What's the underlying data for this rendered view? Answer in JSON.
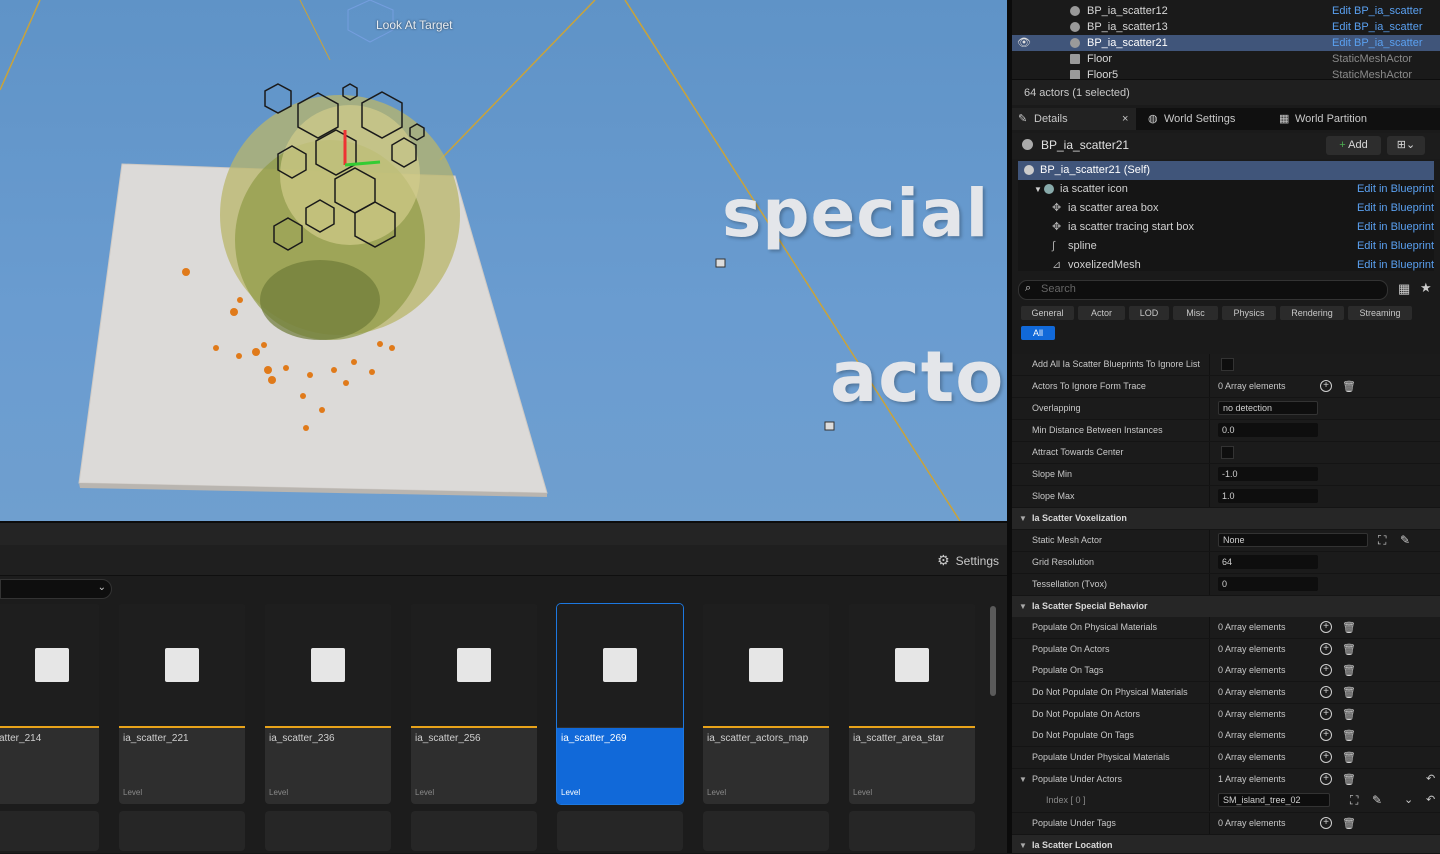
{
  "viewport": {
    "look_at_label": "Look At Target",
    "overlay_text_1": "special",
    "overlay_text_2": "acto"
  },
  "content_browser": {
    "settings_label": "Settings",
    "tiles": [
      {
        "name": "atter_214",
        "type": ""
      },
      {
        "name": "ia_scatter_221",
        "type": "Level"
      },
      {
        "name": "ia_scatter_236",
        "type": "Level"
      },
      {
        "name": "ia_scatter_256",
        "type": "Level"
      },
      {
        "name": "ia_scatter_269",
        "type": "Level"
      },
      {
        "name": "ia_scatter_actors_map",
        "type": "Level"
      },
      {
        "name": "ia_scatter_area_star",
        "type": "Level"
      }
    ]
  },
  "outliner": {
    "rows": [
      {
        "name": "BP_ia_scatter12",
        "type": "Edit BP_ia_scatter"
      },
      {
        "name": "BP_ia_scatter13",
        "type": "Edit BP_ia_scatter"
      },
      {
        "name": "BP_ia_scatter21",
        "type": "Edit BP_ia_scatter"
      },
      {
        "name": "Floor",
        "type": "StaticMeshActor"
      },
      {
        "name": "Floor5",
        "type": "StaticMeshActor"
      }
    ],
    "count": "64 actors (1 selected)"
  },
  "tabs": {
    "details": "Details",
    "world_settings": "World Settings",
    "world_partition": "World Partition"
  },
  "details": {
    "actor_name": "BP_ia_scatter21",
    "add_label": "Add",
    "components": [
      {
        "name": "BP_ia_scatter21 (Self)",
        "link": ""
      },
      {
        "name": "ia scatter icon",
        "link": "Edit in Blueprint"
      },
      {
        "name": "ia scatter area box",
        "link": "Edit in Blueprint"
      },
      {
        "name": "ia scatter tracing start box",
        "link": "Edit in Blueprint"
      },
      {
        "name": "spline",
        "link": "Edit in Blueprint"
      },
      {
        "name": "voxelizedMesh",
        "link": "Edit in Blueprint"
      }
    ],
    "search_placeholder": "Search",
    "categories": [
      "General",
      "Actor",
      "LOD",
      "Misc",
      "Physics",
      "Rendering",
      "Streaming",
      "All"
    ],
    "props": {
      "p1": {
        "label": "Add All Ia Scatter Blueprints To Ignore List"
      },
      "p2": {
        "label": "Actors To Ignore Form Trace",
        "value": "0 Array elements"
      },
      "p3": {
        "label": "Overlapping",
        "value": "no detection"
      },
      "p4": {
        "label": "Min Distance Between Instances",
        "value": "0.0"
      },
      "p5": {
        "label": "Attract Towards Center"
      },
      "p6": {
        "label": "Slope Min",
        "value": "-1.0"
      },
      "p7": {
        "label": "Slope Max",
        "value": "1.0"
      },
      "s1": {
        "label": "Ia Scatter Voxelization"
      },
      "p8": {
        "label": "Static Mesh Actor",
        "value": "None"
      },
      "p9": {
        "label": "Grid Resolution",
        "value": "64"
      },
      "p10": {
        "label": "Tessellation (Tvox)",
        "value": "0"
      },
      "s2": {
        "label": "Ia Scatter Special Behavior"
      },
      "p11": {
        "label": "Populate On Physical Materials",
        "value": "0 Array elements"
      },
      "p12": {
        "label": "Populate On Actors",
        "value": "0 Array elements"
      },
      "p13": {
        "label": "Populate On Tags",
        "value": "0 Array elements"
      },
      "p14": {
        "label": "Do Not Populate On Physical Materials",
        "value": "0 Array elements"
      },
      "p15": {
        "label": "Do Not Populate On Actors",
        "value": "0 Array elements"
      },
      "p16": {
        "label": "Do Not Populate On Tags",
        "value": "0 Array elements"
      },
      "p17": {
        "label": "Populate Under Physical Materials",
        "value": "0 Array elements"
      },
      "p18": {
        "label": "Populate Under Actors",
        "value": "1 Array elements"
      },
      "p19": {
        "label": "Index [ 0 ]",
        "value": "SM_island_tree_02"
      },
      "p20": {
        "label": "Populate Under Tags",
        "value": "0 Array elements"
      },
      "s3": {
        "label": "Ia Scatter Location"
      }
    }
  }
}
